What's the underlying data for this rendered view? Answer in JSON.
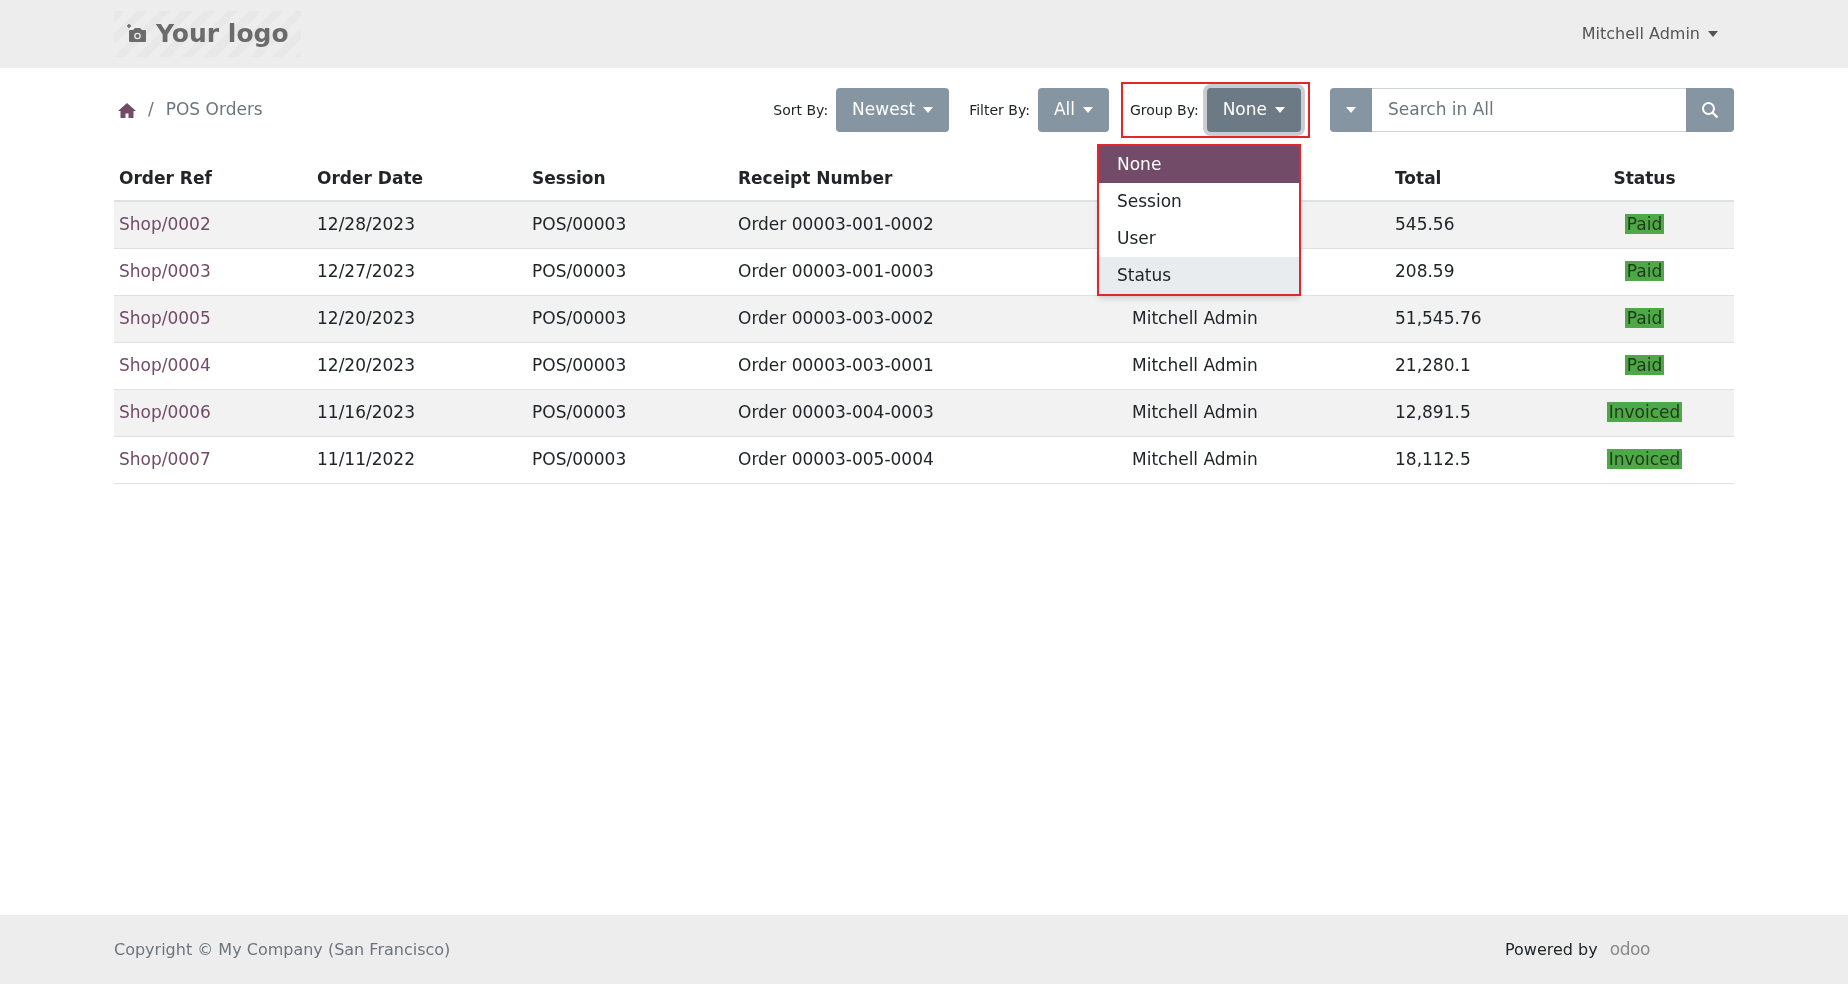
{
  "header": {
    "logo": "Your logo",
    "user_menu": "Mitchell Admin"
  },
  "breadcrumb": {
    "separator": "/",
    "items": [
      "POS Orders"
    ]
  },
  "toolbar": {
    "sort": {
      "label": "Sort By:",
      "value": "Newest"
    },
    "filter": {
      "label": "Filter By:",
      "value": "All"
    },
    "group": {
      "label": "Group By:",
      "value": "None",
      "highlighted": true
    },
    "search": {
      "placeholder": "Search in All"
    }
  },
  "group_dropdown": {
    "highlighted": true,
    "options": [
      {
        "label": "None",
        "selected": true,
        "hovered": false
      },
      {
        "label": "Session",
        "selected": false,
        "hovered": false
      },
      {
        "label": "User",
        "selected": false,
        "hovered": false
      },
      {
        "label": "Status",
        "selected": false,
        "hovered": true
      }
    ]
  },
  "table": {
    "columns": [
      "Order Ref",
      "Order Date",
      "Session",
      "Receipt Number",
      "Total",
      "Status"
    ],
    "rows": [
      {
        "order_ref": "Shop/0002",
        "order_date": "12/28/2023",
        "session": "POS/00003",
        "receipt_number": "Order 00003-001-0002",
        "total": "545.56",
        "status": "Paid"
      },
      {
        "order_ref": "Shop/0003",
        "order_date": "12/27/2023",
        "session": "POS/00003",
        "receipt_number": "Order 00003-001-0003",
        "total": "208.59",
        "status": "Paid"
      },
      {
        "order_ref": "Shop/0005",
        "order_date": "12/20/2023",
        "session": "POS/00003",
        "receipt_number": "Order 00003-003-0002",
        "column_5": "Mitchell Admin",
        "total": "51,545.76",
        "status": "Paid"
      },
      {
        "order_ref": "Shop/0004",
        "order_date": "12/20/2023",
        "session": "POS/00003",
        "receipt_number": "Order 00003-003-0001",
        "column_5": "Mitchell Admin",
        "total": "21,280.1",
        "status": "Paid"
      },
      {
        "order_ref": "Shop/0006",
        "order_date": "11/16/2023",
        "session": "POS/00003",
        "receipt_number": "Order 00003-004-0003",
        "column_5": "Mitchell Admin",
        "total": "12,891.5",
        "status": "Invoiced"
      },
      {
        "order_ref": "Shop/0007",
        "order_date": "11/11/2022",
        "session": "POS/00003",
        "receipt_number": "Order 00003-005-0004",
        "column_5": "Mitchell Admin",
        "total": "18,112.5",
        "status": "Invoiced"
      }
    ]
  },
  "footer": {
    "copyright": "Copyright © My Company (San Francisco)",
    "powered_by": "Powered by",
    "brand": "odoo"
  }
}
